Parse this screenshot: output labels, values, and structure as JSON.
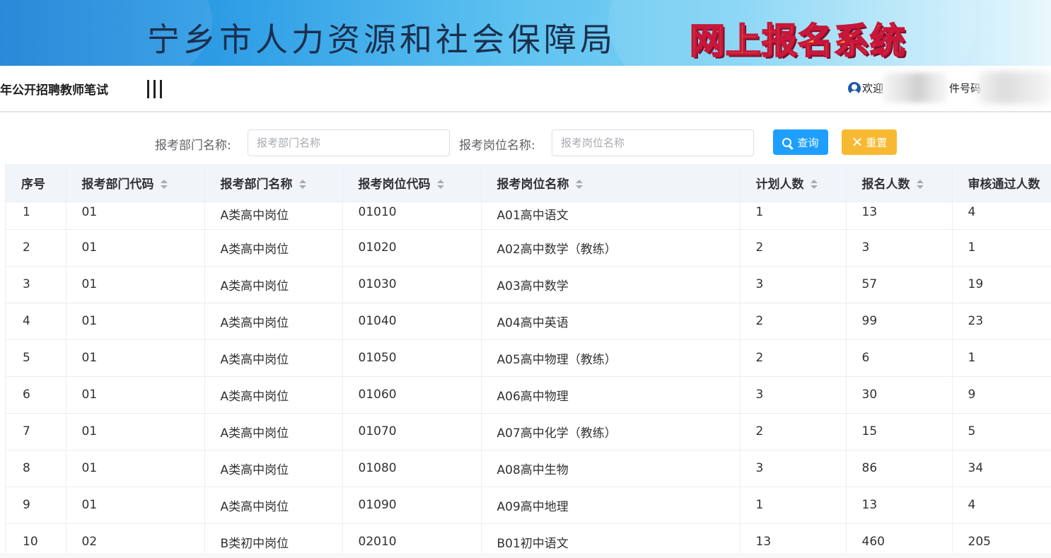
{
  "banner": {
    "title": "宁乡市人力资源和社会保障局",
    "subtitle": "网上报名系统"
  },
  "header": {
    "exam_title": "年公开招聘教师笔试",
    "welcome": "欢迎",
    "id_label": "件号码"
  },
  "search": {
    "dept_label": "报考部门名称:",
    "dept_placeholder": "报考部门名称",
    "post_label": "报考岗位名称:",
    "post_placeholder": "报考岗位名称",
    "search_button": "查询",
    "reset_button": "重置"
  },
  "table": {
    "columns": [
      "序号",
      "报考部门代码",
      "报考部门名称",
      "报考岗位代码",
      "报考岗位名称",
      "计划人数",
      "报名人数",
      "审核通过人数"
    ],
    "rows": [
      [
        "1",
        "01",
        "A类高中岗位",
        "01010",
        "A01高中语文",
        "1",
        "13",
        "4"
      ],
      [
        "2",
        "01",
        "A类高中岗位",
        "01020",
        "A02高中数学（教练）",
        "2",
        "3",
        "1"
      ],
      [
        "3",
        "01",
        "A类高中岗位",
        "01030",
        "A03高中数学",
        "3",
        "57",
        "19"
      ],
      [
        "4",
        "01",
        "A类高中岗位",
        "01040",
        "A04高中英语",
        "2",
        "99",
        "23"
      ],
      [
        "5",
        "01",
        "A类高中岗位",
        "01050",
        "A05高中物理（教练）",
        "2",
        "6",
        "1"
      ],
      [
        "6",
        "01",
        "A类高中岗位",
        "01060",
        "A06高中物理",
        "3",
        "30",
        "9"
      ],
      [
        "7",
        "01",
        "A类高中岗位",
        "01070",
        "A07高中化学（教练）",
        "2",
        "15",
        "5"
      ],
      [
        "8",
        "01",
        "A类高中岗位",
        "01080",
        "A08高中生物",
        "3",
        "86",
        "34"
      ],
      [
        "9",
        "01",
        "A类高中岗位",
        "01090",
        "A09高中地理",
        "1",
        "13",
        "4"
      ],
      [
        "10",
        "02",
        "B类初中岗位",
        "02010",
        "B01初中语文",
        "13",
        "460",
        "205"
      ]
    ]
  },
  "colors": {
    "primary_button": "#1e9fff",
    "reset_button": "#f7b932",
    "header_bg": "#f1f4f8",
    "banner_start": "#1a7fd6"
  },
  "icons": {
    "user": "user-circle-icon",
    "menu": "menu-toggle-icon",
    "search": "search-icon",
    "reset": "close-icon",
    "sort": "sort-caret-icon"
  }
}
